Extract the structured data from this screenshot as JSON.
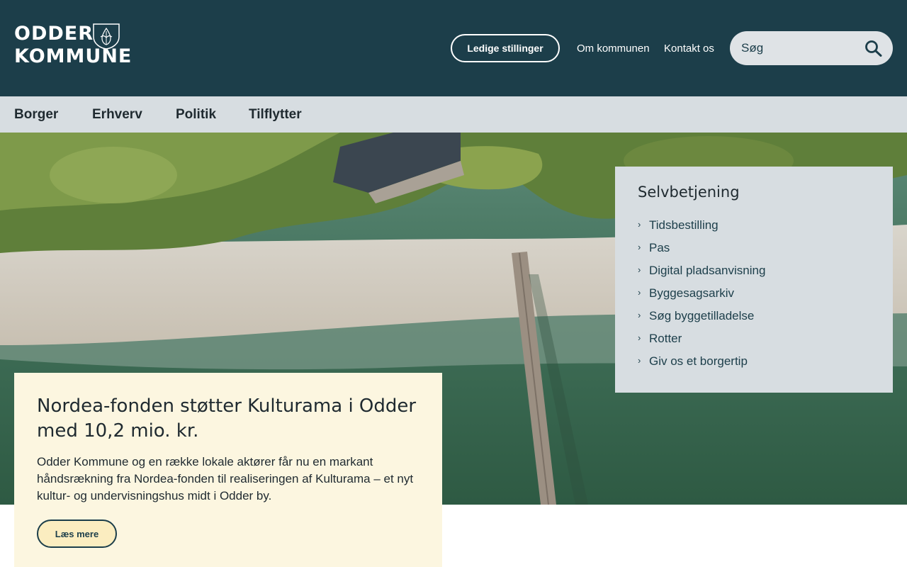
{
  "logo": {
    "line1": "ODDER",
    "line2": "KOMMUNE"
  },
  "header": {
    "jobs_label": "Ledige stillinger",
    "links": [
      "Om kommunen",
      "Kontakt os"
    ],
    "search": {
      "placeholder": "Søg",
      "icon": "search-icon"
    }
  },
  "nav": {
    "items": [
      "Borger",
      "Erhverv",
      "Politik",
      "Tilflytter"
    ]
  },
  "selfservice": {
    "title": "Selvbetjening",
    "items": [
      "Tidsbestilling",
      "Pas",
      "Digital pladsanvisning",
      "Byggesagsarkiv",
      "Søg byggetilladelse",
      "Rotter",
      "Giv os et borgertip"
    ],
    "chevron": "›"
  },
  "news": {
    "title": "Nordea-fonden støtter Kulturama i Odder med 10,2 mio. kr.",
    "body": "Odder Kommune og en række lokale aktører får nu en markant håndsrækning fra Nordea-fonden til realiseringen af Kulturama – et nyt kultur- og undervisningshus midt i Odder by.",
    "button": "Læs mere"
  },
  "colors": {
    "header_bg": "#1c3e4a",
    "nav_bg": "#d7dde1",
    "news_bg": "#fcf6e0",
    "button_more_bg": "#fbedc0"
  }
}
